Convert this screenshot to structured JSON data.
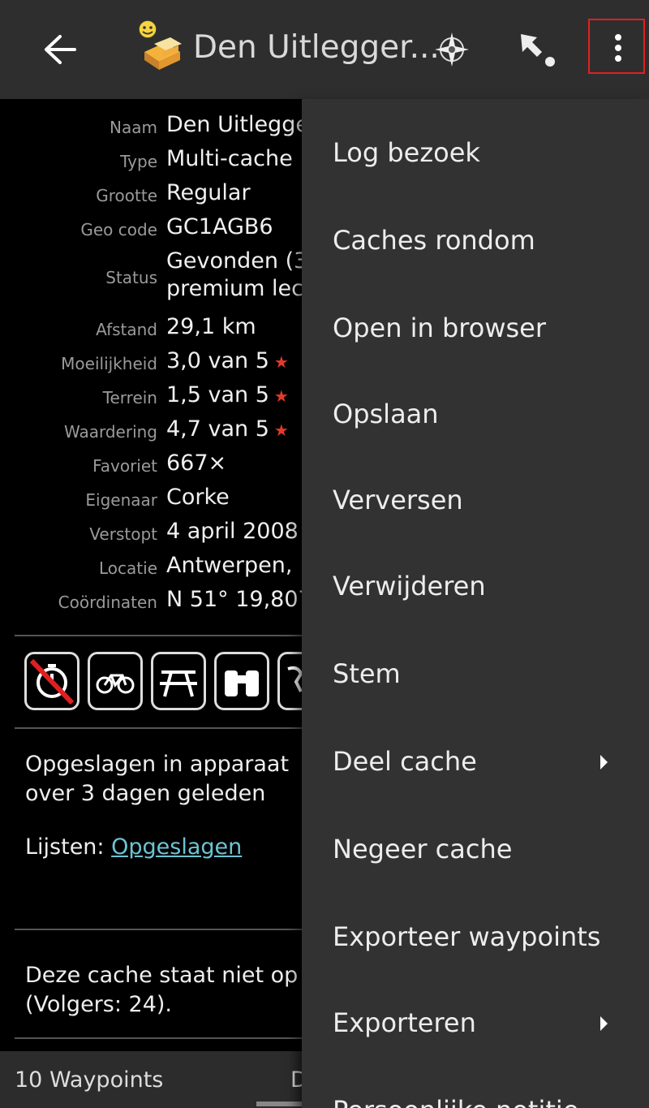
{
  "toolbar": {
    "title": "Den Uitlegger...",
    "icons": [
      "back-arrow-icon",
      "multi-cache-icon",
      "compass-icon",
      "navigate-icon",
      "overflow-menu-icon"
    ]
  },
  "details": [
    {
      "label": "Naam",
      "value": "Den Uitlegge"
    },
    {
      "label": "Type",
      "value": "Multi-cache"
    },
    {
      "label": "Grootte",
      "value": "Regular"
    },
    {
      "label": "Geo code",
      "value": "GC1AGB6"
    },
    {
      "label": "Status",
      "value": "Gevonden (3",
      "value2": "premium lec"
    },
    {
      "label": "Afstand",
      "value": "29,1 km"
    },
    {
      "label": "Moeilijkheid",
      "value": "3,0 van 5"
    },
    {
      "label": "Terrein",
      "value": "1,5 van 5"
    },
    {
      "label": "Waardering",
      "value": "4,7 van 5"
    },
    {
      "label": "Favoriet",
      "value": "667×"
    },
    {
      "label": "Eigenaar",
      "value": "Corke"
    },
    {
      "label": "Verstopt",
      "value": "4 april 2008"
    },
    {
      "label": "Locatie",
      "value": "Antwerpen,"
    },
    {
      "label": "Coördinaten",
      "value": "N 51° 19,807"
    }
  ],
  "attributes": [
    "no-stopwatch-icon",
    "bicycle-icon",
    "picnic-table-icon",
    "binoculars-icon",
    "partial-attribute-icon"
  ],
  "stored": {
    "line1": "Opgeslagen in apparaat",
    "line2": "over 3 dagen geleden",
    "lists_label": "Lijsten: ",
    "lists_link": "Opgeslagen"
  },
  "watch": {
    "line1": "Deze cache staat niet op",
    "line2": "(Volgers: 24)."
  },
  "bottom": {
    "waypoints": "10 Waypoints",
    "next_tab": "D"
  },
  "menu": [
    {
      "label": "Log bezoek"
    },
    {
      "label": "Caches rondom"
    },
    {
      "label": "Open in browser"
    },
    {
      "label": "Opslaan"
    },
    {
      "label": "Verversen"
    },
    {
      "label": "Verwijderen"
    },
    {
      "label": "Stem"
    },
    {
      "label": "Deel cache",
      "submenu": true
    },
    {
      "label": "Negeer cache"
    },
    {
      "label": "Exporteer waypoints"
    },
    {
      "label": "Exporteren",
      "submenu": true
    },
    {
      "label": "Persoonlijke notitie"
    }
  ],
  "colors": {
    "toolbar_bg": "#2e2e2e",
    "menu_bg": "#323232",
    "star": "#e53b2c",
    "link": "#6cc4d4",
    "highlight": "#e02020"
  }
}
